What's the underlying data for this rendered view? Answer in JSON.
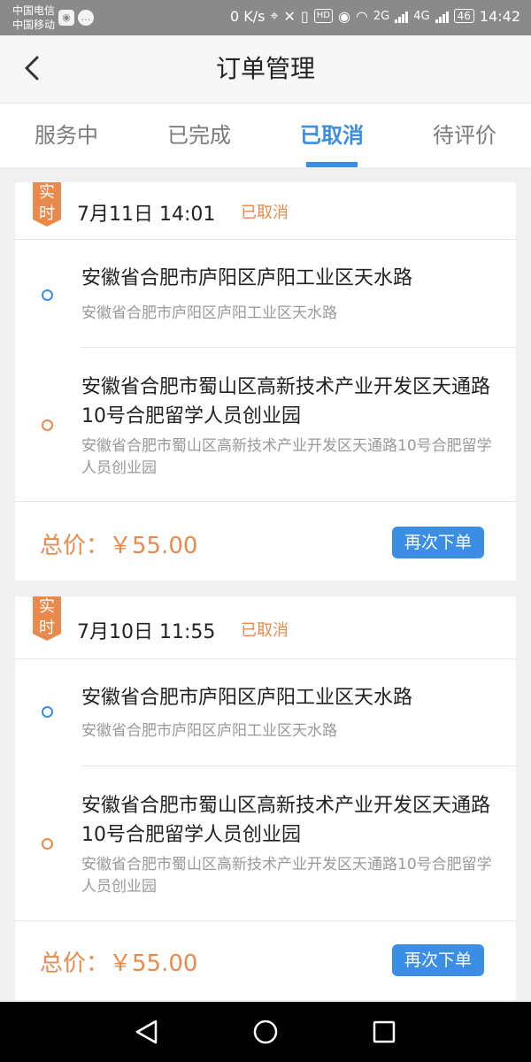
{
  "status_bar": {
    "carrier1": "中国电信",
    "carrier2": "中国移动",
    "speed": "0 K/s",
    "hd": "HD",
    "net_2g": "2G",
    "net_4g": "4G",
    "battery": "46",
    "time": "14:42"
  },
  "header": {
    "title": "订单管理"
  },
  "tabs": [
    {
      "label": "服务中"
    },
    {
      "label": "已完成"
    },
    {
      "label": "已取消"
    },
    {
      "label": "待评价"
    }
  ],
  "active_tab": 2,
  "orders": [
    {
      "badge_line1": "实",
      "badge_line2": "时",
      "datetime": "7月11日  14:01",
      "status": "已取消",
      "from_main": "安徽省合肥市庐阳区庐阳工业区天水路",
      "from_sub": "安徽省合肥市庐阳区庐阳工业区天水路",
      "to_main": "安徽省合肥市蜀山区高新技术产业开发区天通路10号合肥留学人员创业园",
      "to_sub": "安徽省合肥市蜀山区高新技术产业开发区天通路10号合肥留学人员创业园",
      "price": "总价：￥55.00",
      "reorder_label": "再次下单"
    },
    {
      "badge_line1": "实",
      "badge_line2": "时",
      "datetime": "7月10日  11:55",
      "status": "已取消",
      "from_main": "安徽省合肥市庐阳区庐阳工业区天水路",
      "from_sub": "安徽省合肥市庐阳区庐阳工业区天水路",
      "to_main": "安徽省合肥市蜀山区高新技术产业开发区天通路10号合肥留学人员创业园",
      "to_sub": "安徽省合肥市蜀山区高新技术产业开发区天通路10号合肥留学人员创业园",
      "price": "总价：￥55.00",
      "reorder_label": "再次下单"
    }
  ],
  "colors": {
    "accent": "#3a8ee6",
    "orange": "#e98a4c"
  }
}
